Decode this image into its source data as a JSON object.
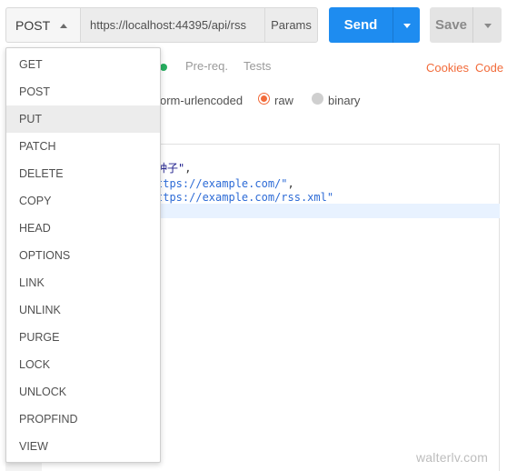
{
  "request": {
    "method": "POST",
    "url": "https://localhost:44395/api/rss",
    "params_label": "Params",
    "send_label": "Send",
    "save_label": "Save"
  },
  "tabs": {
    "prereq": "Pre-req.",
    "tests": "Tests",
    "cookies": "Cookies",
    "code": "Code"
  },
  "body_types": {
    "urlencoded": "orm-urlencoded",
    "raw": "raw",
    "binary": "binary",
    "selected": "raw"
  },
  "editor": {
    "lines": [
      {
        "dark": "种子\"",
        "plain": ","
      },
      {
        "str": "ttps://example.com/\"",
        "plain": ","
      },
      {
        "str": "ttps://example.com/rss.xml\""
      }
    ]
  },
  "method_dropdown": {
    "hovered": "PUT",
    "items": [
      "GET",
      "POST",
      "PUT",
      "PATCH",
      "DELETE",
      "COPY",
      "HEAD",
      "OPTIONS",
      "LINK",
      "UNLINK",
      "PURGE",
      "LOCK",
      "UNLOCK",
      "PROPFIND",
      "VIEW"
    ]
  },
  "watermark": "walterlv.com",
  "colors": {
    "send": "#1e8cf0",
    "accent": "#f26b3a",
    "tab_dot": "#27ae60"
  }
}
